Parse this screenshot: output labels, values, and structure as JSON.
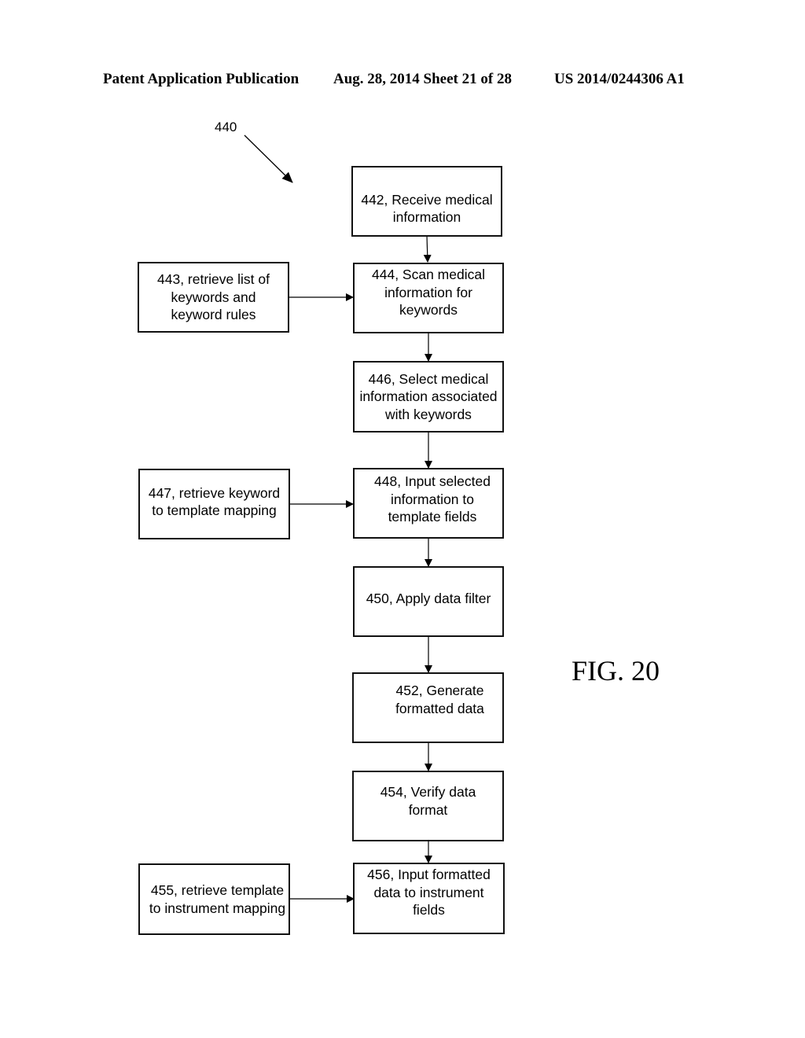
{
  "header": {
    "left": "Patent Application Publication",
    "middle": "Aug. 28, 2014  Sheet 21 of 28",
    "right": "US 2014/0244306 A1"
  },
  "figure": {
    "label": "FIG. 20",
    "reference": "440"
  },
  "steps": {
    "s442": "442, Receive medical\ninformation",
    "s443": "443, retrieve list of\nkeywords and\nkeyword rules",
    "s444": "444, Scan medical\ninformation for\nkeywords",
    "s446": "446, Select medical\ninformation associated\nwith keywords",
    "s447": "447, retrieve keyword\nto template mapping",
    "s448": "448, Input selected\ninformation to\ntemplate fields",
    "s450": "450, Apply data filter",
    "s452": "452, Generate\nformatted data",
    "s454": "454, Verify data\nformat",
    "s455": "455, retrieve template\nto instrument mapping",
    "s456": "456, Input formatted\ndata to instrument\nfields"
  },
  "edges": [
    [
      "442",
      "444"
    ],
    [
      "443",
      "444"
    ],
    [
      "444",
      "446"
    ],
    [
      "446",
      "448"
    ],
    [
      "447",
      "448"
    ],
    [
      "448",
      "450"
    ],
    [
      "450",
      "452"
    ],
    [
      "452",
      "454"
    ],
    [
      "454",
      "456"
    ],
    [
      "455",
      "456"
    ]
  ]
}
